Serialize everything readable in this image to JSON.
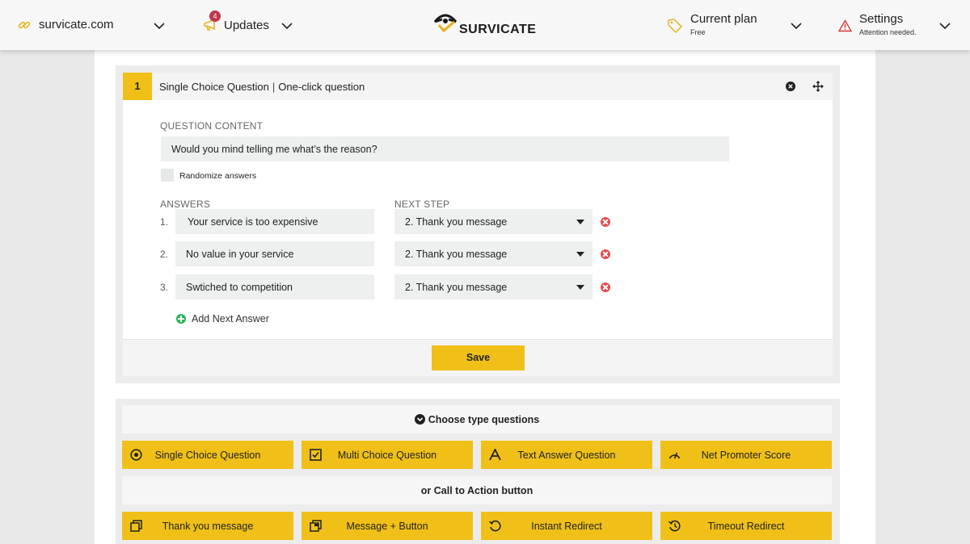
{
  "topbar": {
    "site": "survicate.com",
    "updates_label": "Updates",
    "updates_count": "4",
    "logo_text": "SURVICATE",
    "plan_label": "Current plan",
    "plan_sub": "Free",
    "settings_label": "Settings",
    "settings_sub": "Attention needed."
  },
  "question": {
    "number": "1",
    "type": "Single Choice Question",
    "separator": "|",
    "subtype": "One-click question",
    "content_label": "QUESTION CONTENT",
    "content_value": "Would you mind telling me what’s the reason?",
    "randomize_label": "Randomize answers",
    "answers_label": "ANSWERS",
    "next_step_label": "NEXT STEP",
    "answers": [
      {
        "num": "1.",
        "text": "Your service is too expensive",
        "next": "2. Thank you message"
      },
      {
        "num": "2.",
        "text": "No value in your service",
        "next": "2. Thank you message"
      },
      {
        "num": "3.",
        "text": "Swtiched to competition",
        "next": "2. Thank you message"
      }
    ],
    "add_answer": "Add Next Answer",
    "save_label": "Save"
  },
  "types": {
    "choose_label": "Choose type questions",
    "question_types": [
      {
        "label": "Single Choice Question",
        "icon": "radio-icon"
      },
      {
        "label": "Multi Choice Question",
        "icon": "checkbox-icon"
      },
      {
        "label": "Text Answer Question",
        "icon": "text-icon"
      },
      {
        "label": "Net Promoter Score",
        "icon": "gauge-icon"
      }
    ],
    "cta_label": "or Call to Action button",
    "cta_types": [
      {
        "label": "Thank you message",
        "icon": "message-icon"
      },
      {
        "label": "Message + Button",
        "icon": "message-button-icon"
      },
      {
        "label": "Instant Redirect",
        "icon": "redirect-icon"
      },
      {
        "label": "Timeout Redirect",
        "icon": "timeout-icon"
      }
    ]
  },
  "colors": {
    "accent": "#f0c018",
    "danger": "#e34b4b",
    "success": "#27b35a",
    "badge": "#c0364a"
  }
}
